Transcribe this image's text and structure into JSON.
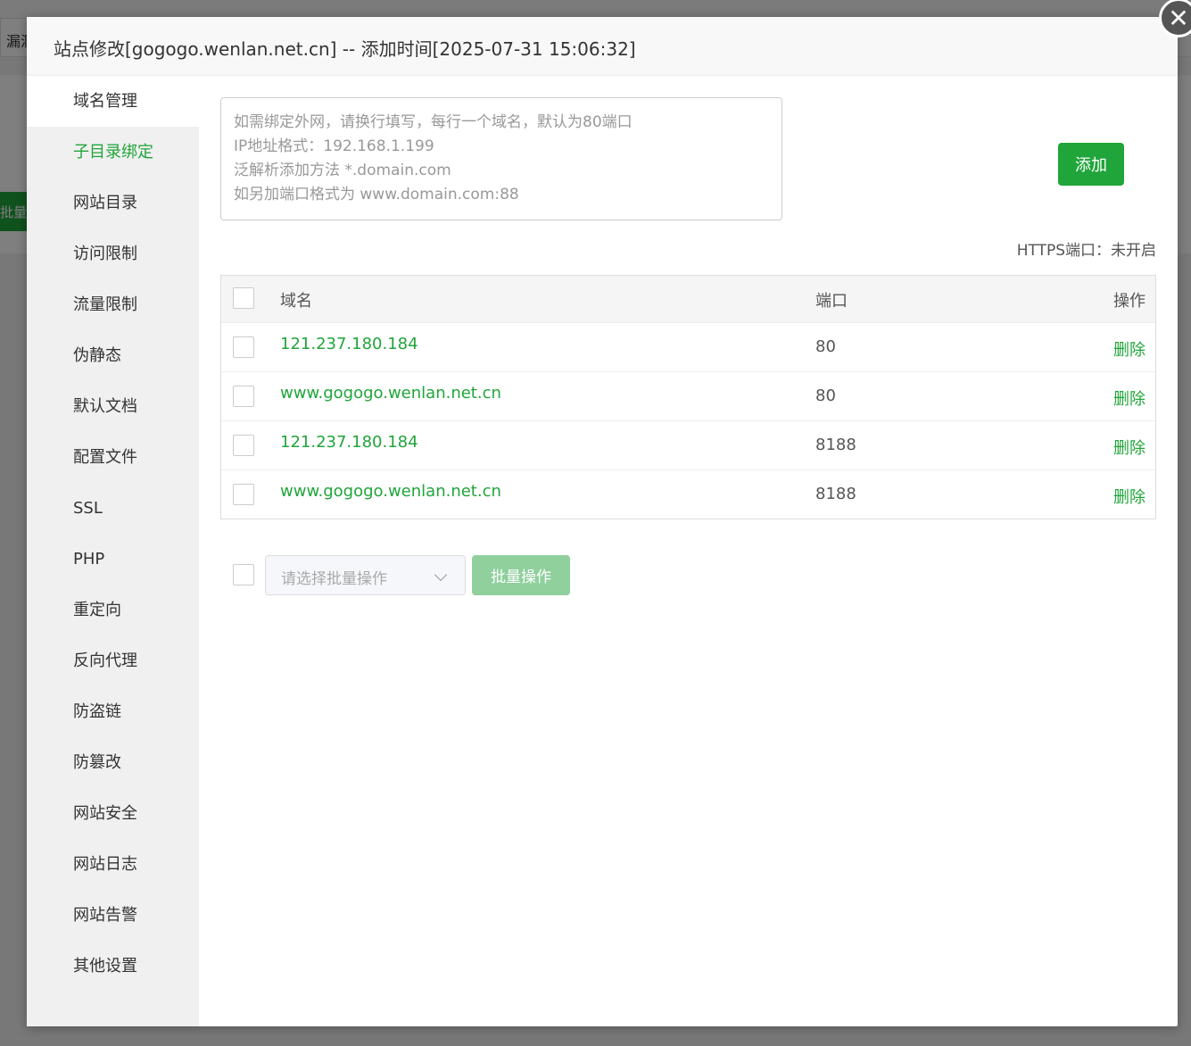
{
  "background": {
    "tab_label": "漏洞",
    "button_label": "批量"
  },
  "modal": {
    "title": "站点修改[gogogo.wenlan.net.cn] -- 添加时间[2025-07-31 15:06:32]",
    "close_icon": "close-icon"
  },
  "sidebar": {
    "items": [
      {
        "label": "域名管理"
      },
      {
        "label": "子目录绑定"
      },
      {
        "label": "网站目录"
      },
      {
        "label": "访问限制"
      },
      {
        "label": "流量限制"
      },
      {
        "label": "伪静态"
      },
      {
        "label": "默认文档"
      },
      {
        "label": "配置文件"
      },
      {
        "label": "SSL"
      },
      {
        "label": "PHP"
      },
      {
        "label": "重定向"
      },
      {
        "label": "反向代理"
      },
      {
        "label": "防盗链"
      },
      {
        "label": "防篡改"
      },
      {
        "label": "网站安全"
      },
      {
        "label": "网站日志"
      },
      {
        "label": "网站告警"
      },
      {
        "label": "其他设置"
      }
    ]
  },
  "domain_form": {
    "placeholder_lines": [
      "如需绑定外网，请换行填写，每行一个域名，默认为80端口",
      "IP地址格式：192.168.1.199",
      "泛解析添加方法 *.domain.com",
      "如另加端口格式为 www.domain.com:88"
    ],
    "add_label": "添加",
    "https_status": "HTTPS端口：未开启"
  },
  "table": {
    "headers": {
      "domain": "域名",
      "port": "端口",
      "action": "操作"
    },
    "rows": [
      {
        "domain": "121.237.180.184",
        "port": "80",
        "action": "删除"
      },
      {
        "domain": "www.gogogo.wenlan.net.cn",
        "port": "80",
        "action": "删除"
      },
      {
        "domain": "121.237.180.184",
        "port": "8188",
        "action": "删除"
      },
      {
        "domain": "www.gogogo.wenlan.net.cn",
        "port": "8188",
        "action": "删除"
      }
    ]
  },
  "batch": {
    "select_placeholder": "请选择批量操作",
    "button_label": "批量操作"
  },
  "colors": {
    "accent": "#20a53a",
    "accent_disabled": "#8fd09d"
  }
}
